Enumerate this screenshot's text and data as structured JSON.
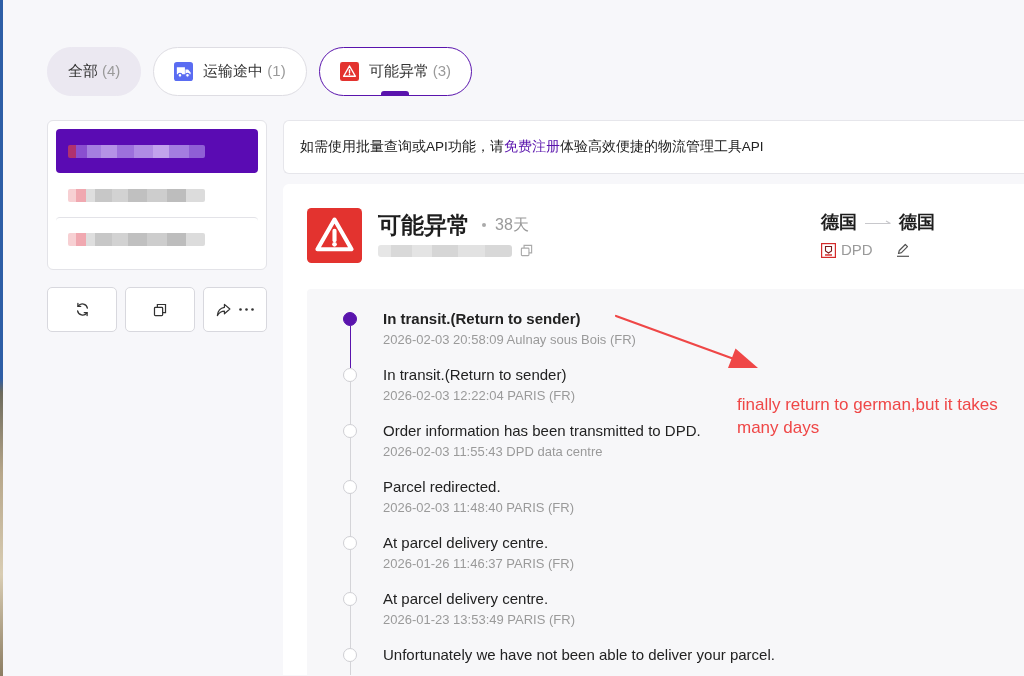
{
  "tabs": [
    {
      "kind": "all",
      "label": "全部",
      "count": "(4)",
      "selected": false
    },
    {
      "kind": "transit",
      "label": "运输途中",
      "count": "(1)",
      "selected": false
    },
    {
      "kind": "alert",
      "label": "可能异常",
      "count": "(3)",
      "selected": true
    }
  ],
  "tracking_list": [
    {
      "selected": true
    },
    {
      "selected": false
    },
    {
      "selected": false
    }
  ],
  "notice": {
    "before": "如需使用批量查询或API功能，请",
    "link": "免费注册",
    "after": "体验高效便捷的物流管理工具API"
  },
  "shipment": {
    "status": "可能异常",
    "days": "38天",
    "origin": "德国",
    "destination": "德国",
    "carrier": "DPD"
  },
  "events": [
    {
      "title": "In transit.(Return to sender)",
      "details": "2026-02-03 20:58:09 Aulnay sous Bois (FR)",
      "latest": true
    },
    {
      "title": "In transit.(Return to sender)",
      "details": "2026-02-03 12:22:04 PARIS (FR)",
      "latest": false
    },
    {
      "title": "Order information has been transmitted to DPD.",
      "details": "2026-02-03 11:55:43 DPD data centre",
      "latest": false
    },
    {
      "title": "Parcel redirected.",
      "details": "2026-02-03 11:48:40 PARIS (FR)",
      "latest": false
    },
    {
      "title": "At parcel delivery centre.",
      "details": "2026-01-26 11:46:37 PARIS (FR)",
      "latest": false
    },
    {
      "title": "At parcel delivery centre.",
      "details": "2026-01-23 13:53:49 PARIS (FR)",
      "latest": false
    },
    {
      "title": "Unfortunately we have not been able to deliver your parcel.",
      "latest": false
    }
  ],
  "annotation": {
    "text": "finally return to german,but it takes many days"
  }
}
